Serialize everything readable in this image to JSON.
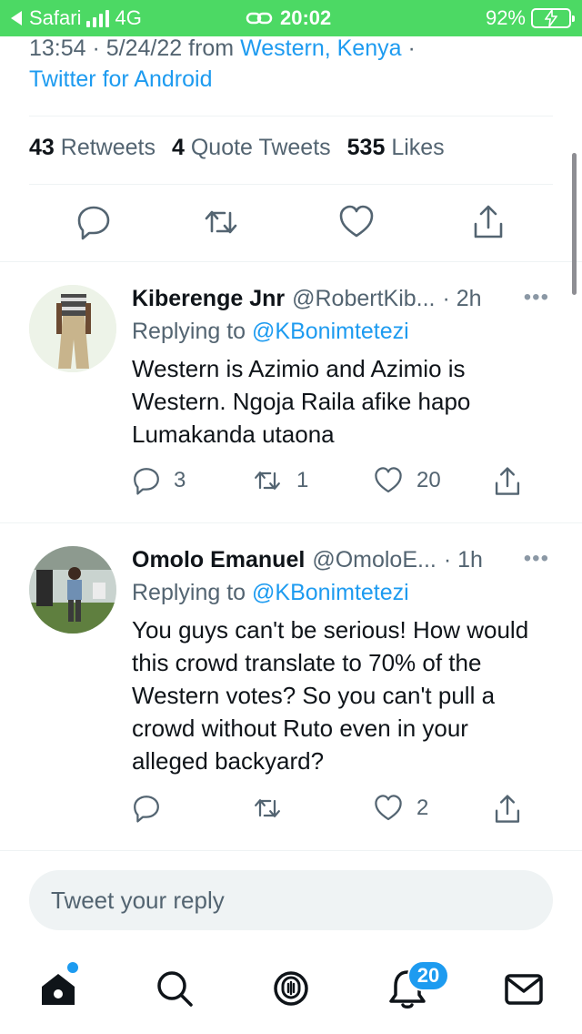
{
  "status_bar": {
    "back_label": "Safari",
    "network": "4G",
    "time": "20:02",
    "battery": "92%"
  },
  "tweet": {
    "timestamp": "13:54 · 5/24/22 from",
    "location": "Western, Kenya",
    "separator": "·",
    "client": "Twitter for Android",
    "retweets_count": "43",
    "retweets_label": "Retweets",
    "quote_count": "4",
    "quote_label": "Quote Tweets",
    "likes_count": "535",
    "likes_label": "Likes"
  },
  "replies": [
    {
      "name": "Kiberenge Jnr",
      "handle": "@RobertKib...",
      "time": "· 2h",
      "replying_prefix": "Replying to",
      "replying_to": "@KBonimtetezi",
      "text": "Western is Azimio and Azimio is Western. Ngoja Raila afike hapo Lumakanda utaona",
      "reply_count": "3",
      "retweet_count": "1",
      "like_count": "20"
    },
    {
      "name": "Omolo Emanuel",
      "handle": "@OmoloE...",
      "time": "· 1h",
      "replying_prefix": "Replying to",
      "replying_to": "@KBonimtetezi",
      "text": "You guys can't be serious! How would this crowd translate to 70% of the Western votes? So you can't pull a crowd without Ruto even in your alleged backyard?",
      "reply_count": "",
      "retweet_count": "",
      "like_count": "2"
    }
  ],
  "composer": {
    "placeholder": "Tweet your reply"
  },
  "bottom_nav": {
    "notifications_badge": "20"
  },
  "colors": {
    "status_bar": "#4cd964",
    "accent": "#1d9bf0",
    "secondary_text": "#536471"
  }
}
